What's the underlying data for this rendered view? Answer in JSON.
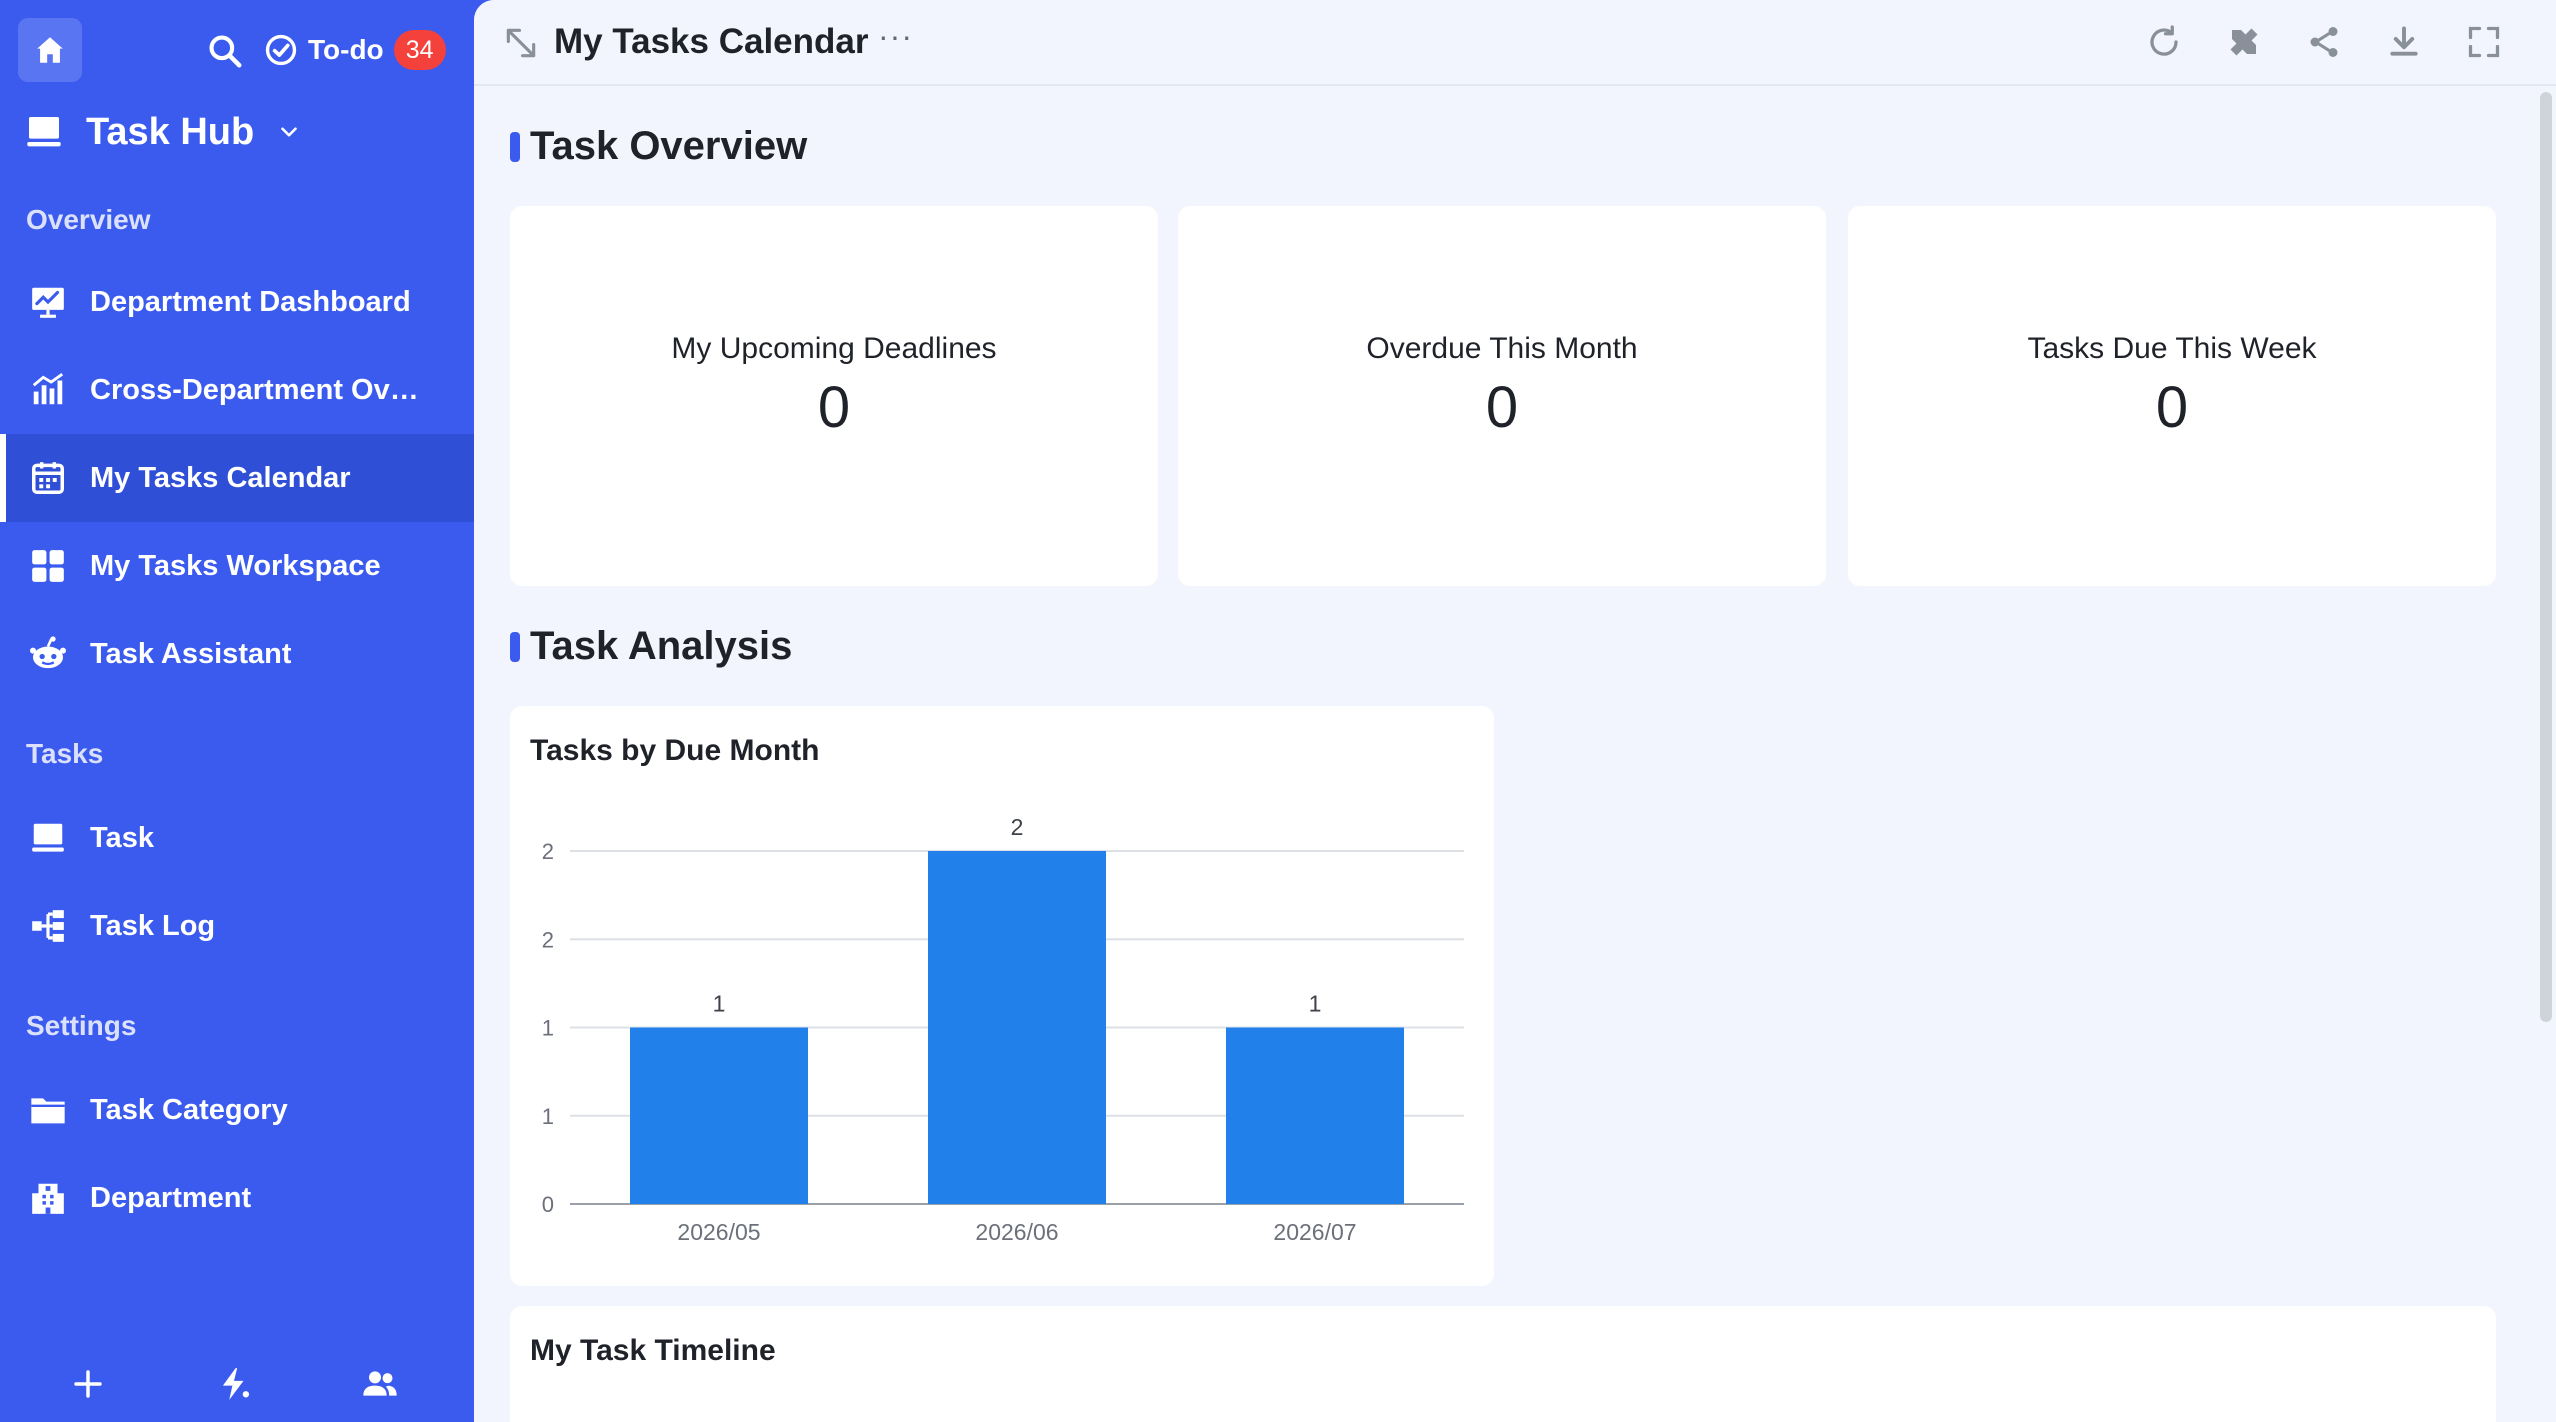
{
  "sidebar": {
    "todo_label": "To-do",
    "todo_count": "34",
    "app_title": "Task Hub",
    "sections": {
      "overview": "Overview",
      "tasks": "Tasks",
      "settings": "Settings"
    },
    "items": {
      "department_dashboard": "Department Dashboard",
      "cross_department": "Cross-Department Overview",
      "my_tasks_calendar": "My Tasks Calendar",
      "my_tasks_workspace": "My Tasks Workspace",
      "task_assistant": "Task Assistant",
      "task": "Task",
      "task_log": "Task Log",
      "task_category": "Task Category",
      "department": "Department"
    },
    "accent": "#3b5bef",
    "active_bg": "#2f4fd6"
  },
  "header": {
    "title": "My Tasks Calendar",
    "more": "···"
  },
  "overview": {
    "title": "Task Overview",
    "stats": [
      {
        "label": "My Upcoming Deadlines",
        "value": "0"
      },
      {
        "label": "Overdue This Month",
        "value": "0"
      },
      {
        "label": "Tasks Due This Week",
        "value": "0"
      }
    ]
  },
  "analysis": {
    "title": "Task Analysis"
  },
  "chart_data": {
    "type": "bar",
    "title": "Tasks by Due Month",
    "categories": [
      "2026/05",
      "2026/06",
      "2026/07"
    ],
    "values": [
      1,
      2,
      1
    ],
    "ylim": [
      0,
      2
    ],
    "y_ticks": [
      0,
      0.5,
      1,
      1.5,
      2
    ],
    "y_tick_labels": [
      "0",
      "1",
      "1",
      "2",
      "2"
    ],
    "data_labels": [
      "1",
      "2",
      "1"
    ],
    "grid": true,
    "bar_color": "#2180ea",
    "xlabel": "",
    "ylabel": ""
  },
  "timeline": {
    "title": "My Task Timeline"
  }
}
